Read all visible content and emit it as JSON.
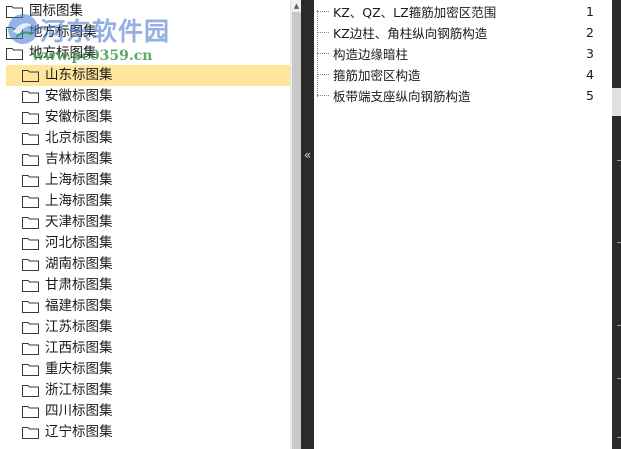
{
  "watermark": {
    "title": "河东软件园",
    "url": "www.pc0359.cn"
  },
  "tree": {
    "items": [
      {
        "label": "国标图集"
      },
      {
        "label": "地方标图集"
      },
      {
        "label": "地方标图集"
      },
      {
        "label": "山东标图集",
        "selected": true
      },
      {
        "label": "安徽标图集"
      },
      {
        "label": "安徽标图集"
      },
      {
        "label": "北京标图集"
      },
      {
        "label": "吉林标图集"
      },
      {
        "label": "上海标图集"
      },
      {
        "label": "上海标图集"
      },
      {
        "label": "天津标图集"
      },
      {
        "label": "河北标图集"
      },
      {
        "label": "湖南标图集"
      },
      {
        "label": "甘肃标图集"
      },
      {
        "label": "福建标图集"
      },
      {
        "label": "江苏标图集"
      },
      {
        "label": "江西标图集"
      },
      {
        "label": "重庆标图集"
      },
      {
        "label": "浙江标图集"
      },
      {
        "label": "四川标图集"
      },
      {
        "label": "辽宁标图集"
      }
    ]
  },
  "splitter": {
    "collapse_glyph": "«"
  },
  "list": {
    "items": [
      {
        "title": "KZ、QZ、LZ箍筋加密区范围",
        "page": "1"
      },
      {
        "title": "KZ边柱、角柱纵向钢筋构造",
        "page": "2"
      },
      {
        "title": "构造边缘暗柱",
        "page": "3"
      },
      {
        "title": "箍筋加密区构造",
        "page": "4"
      },
      {
        "title": "板带端支座纵向钢筋构造",
        "page": "5"
      }
    ]
  },
  "colors": {
    "selected_bg": "#ffe69a",
    "splitter": "#2a2a2a"
  }
}
